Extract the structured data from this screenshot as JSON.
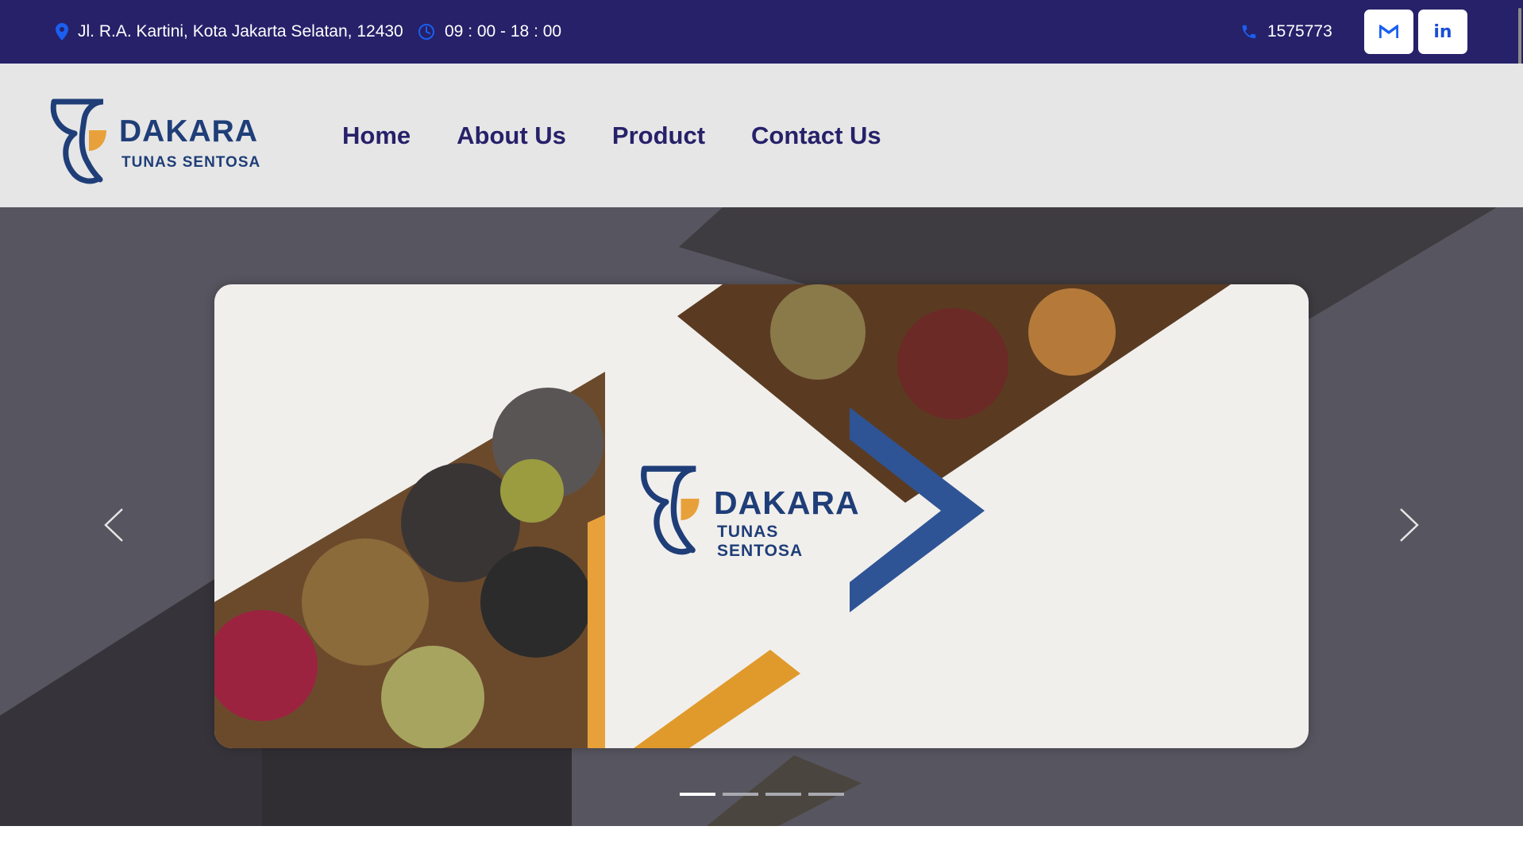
{
  "topbar": {
    "address": "Jl. R.A. Kartini, Kota Jakarta Selatan, 12430",
    "hours": "09 : 00 - 18 : 00",
    "phone": "1575773",
    "icons": {
      "address": "map-pin-icon",
      "hours": "clock-icon",
      "phone": "phone-icon"
    },
    "social": [
      {
        "name": "gmail",
        "icon": "gmail-icon"
      },
      {
        "name": "linkedin",
        "icon": "linkedin-icon",
        "label": "in"
      }
    ]
  },
  "header": {
    "logo_word": "DAKARA",
    "logo_sub": "TUNAS SENTOSA",
    "nav": [
      "Home",
      "About Us",
      "Product",
      "Contact Us"
    ]
  },
  "hero": {
    "slide_logo_word": "DAKARA",
    "slide_logo_sub": "TUNAS SENTOSA",
    "slides_total": 4,
    "active_slide": 1
  },
  "colors": {
    "topbar_bg": "#262169",
    "header_bg": "#e6e6e6",
    "nav_text": "#262169",
    "brand_blue": "#1f3e78",
    "brand_orange": "#e8a13a",
    "icon_blue": "#1a5ff0",
    "hero_bg": "#57555f"
  }
}
